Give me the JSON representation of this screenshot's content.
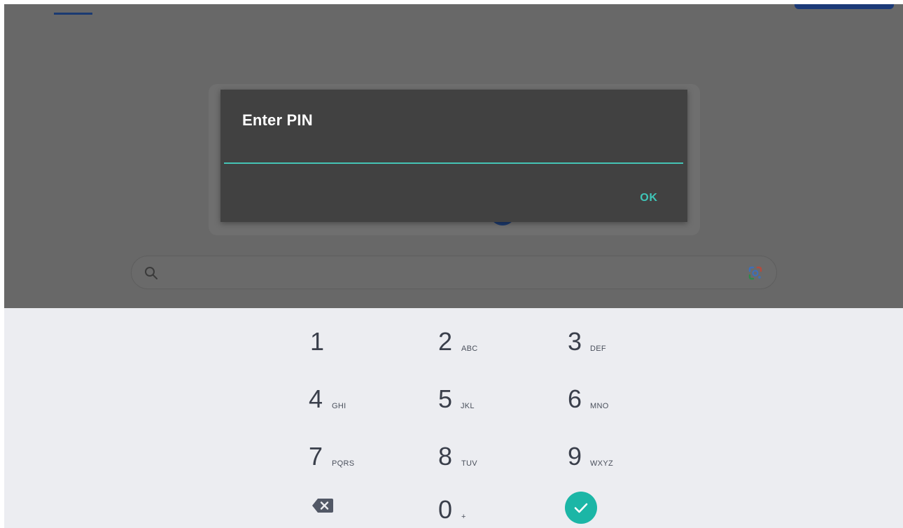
{
  "dialog": {
    "title": "Enter PIN",
    "pin_value": "",
    "ok_label": "OK"
  },
  "keypad": {
    "keys": [
      {
        "num": "1",
        "letters": ""
      },
      {
        "num": "2",
        "letters": "ABC"
      },
      {
        "num": "3",
        "letters": "DEF"
      },
      {
        "num": "4",
        "letters": "GHI"
      },
      {
        "num": "5",
        "letters": "JKL"
      },
      {
        "num": "6",
        "letters": "MNO"
      },
      {
        "num": "7",
        "letters": "PQRS"
      },
      {
        "num": "8",
        "letters": "TUV"
      },
      {
        "num": "9",
        "letters": "WXYZ"
      },
      {
        "num": "0",
        "letters": "+"
      }
    ],
    "backspace_icon": "backspace-icon",
    "done_icon": "checkmark-icon"
  },
  "background": {
    "search_icon": "search-icon",
    "lens_icon": "google-lens-icon"
  },
  "colors": {
    "accent": "#45c4b6",
    "done_button": "#1bb6a6",
    "dialog_bg": "#414141",
    "keyboard_bg": "#ecedf1"
  }
}
